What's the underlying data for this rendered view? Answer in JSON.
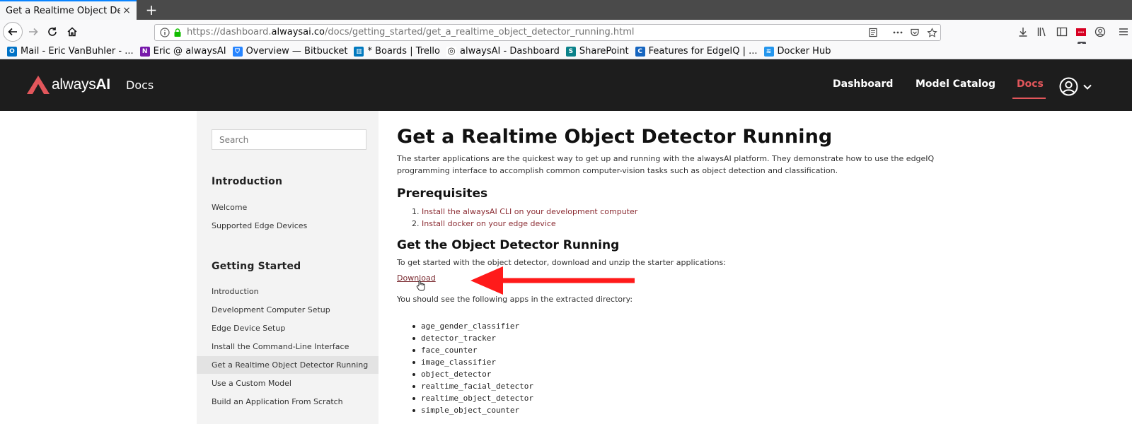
{
  "browser": {
    "tab_title": "Get a Realtime Object Detec",
    "tab_close": "×",
    "new_tab": "+",
    "url_prefix": "https://dashboard.",
    "url_domain": "alwaysai.co",
    "url_path": "/docs/getting_started/get_a_realtime_object_detector_running.html",
    "badge_count": "1",
    "bookmarks": [
      {
        "label": "Mail - Eric VanBuhler - ...",
        "icon": "outlook-icon",
        "color": "#0072c6",
        "glyph": "O"
      },
      {
        "label": "Eric @ alwaysAI",
        "icon": "onenote-icon",
        "color": "#7719aa",
        "glyph": "N"
      },
      {
        "label": "Overview — Bitbucket",
        "icon": "bitbucket-icon",
        "color": "#2684ff",
        "glyph": "⛉"
      },
      {
        "label": "* Boards | Trello",
        "icon": "trello-icon",
        "color": "#0079bf",
        "glyph": "▥"
      },
      {
        "label": "alwaysAI - Dashboard",
        "icon": "globe-icon",
        "color": "#ffffff",
        "glyph": "◎"
      },
      {
        "label": "SharePoint",
        "icon": "sharepoint-icon",
        "color": "#0b828a",
        "glyph": "S"
      },
      {
        "label": "Features for EdgeIQ | ...",
        "icon": "confluence-icon",
        "color": "#1565c0",
        "glyph": "C"
      },
      {
        "label": "Docker Hub",
        "icon": "docker-icon",
        "color": "#2496ed",
        "glyph": "≋"
      }
    ]
  },
  "header": {
    "logo_always": "always",
    "logo_ai": "AI",
    "docs_label": "Docs",
    "nav": [
      "Dashboard",
      "Model Catalog",
      "Docs"
    ],
    "active_nav": "Docs",
    "accent": "#e2565b"
  },
  "sidebar": {
    "search_placeholder": "Search",
    "sections": [
      {
        "heading": "Introduction",
        "items": [
          "Welcome",
          "Supported Edge Devices"
        ]
      },
      {
        "heading": "Getting Started",
        "items": [
          "Introduction",
          "Development Computer Setup",
          "Edge Device Setup",
          "Install the Command-Line Interface",
          "Get a Realtime Object Detector Running",
          "Use a Custom Model",
          "Build an Application From Scratch"
        ]
      }
    ],
    "active_item": "Get a Realtime Object Detector Running"
  },
  "content": {
    "title": "Get a Realtime Object Detector Running",
    "intro_line1": "The starter applications are the quickest way to get up and running with the alwaysAI platform. They demonstrate how to use the edgeIQ",
    "intro_line2": "programming interface to accomplish common computer-vision tasks such as object detection and classification.",
    "prereq_heading": "Prerequisites",
    "prereqs": [
      {
        "num": "1.",
        "text": "Install the alwaysAI CLI on your development computer"
      },
      {
        "num": "2.",
        "text": "Install docker on your edge device"
      }
    ],
    "running_heading": "Get the Object Detector Running",
    "running_text": "To get started with the object detector, download and unzip the starter applications:",
    "download_label": "Download",
    "apps_intro": "You should see the following apps in the extracted directory:",
    "apps": [
      "age_gender_classifier",
      "detector_tracker",
      "face_counter",
      "image_classifier",
      "object_detector",
      "realtime_facial_detector",
      "realtime_object_detector",
      "simple_object_counter"
    ],
    "annotation_arrow_color": "#ff1a1a"
  }
}
